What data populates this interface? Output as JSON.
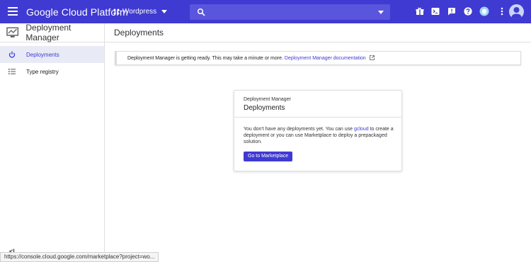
{
  "topbar": {
    "brand": "Google Cloud Platform",
    "project": "Wordpress",
    "search_placeholder": "",
    "colors": {
      "bar": "#3f3ad1",
      "search": "#5a55dd"
    },
    "icons": [
      "gift-icon",
      "cloud-shell-icon",
      "notifications-alert-icon",
      "help-icon",
      "bell-icon",
      "more-icon",
      "account-avatar-icon"
    ]
  },
  "sidebar": {
    "title": "Deployment Manager",
    "items": [
      {
        "label": "Deployments",
        "icon": "power-icon",
        "active": true
      },
      {
        "label": "Type registry",
        "icon": "list-icon",
        "active": false
      }
    ],
    "collapse_label": "<|"
  },
  "main": {
    "title": "Deployments",
    "notice": {
      "text": "Deployment Manager is getting ready. This may take a minute or more.",
      "link": "Deployment Manager documentation"
    },
    "card": {
      "kicker": "Deployment Manager",
      "heading": "Deployments",
      "body_pre": "You don't have any deployments yet. You can use ",
      "body_link": "gcloud",
      "body_post": " to create a deployment or you can use Marketplace to deploy a prepackaged solution.",
      "button": "Go to Marketplace"
    }
  },
  "statusbar": {
    "url": "https://console.cloud.google.com/marketplace?project=wo..."
  }
}
